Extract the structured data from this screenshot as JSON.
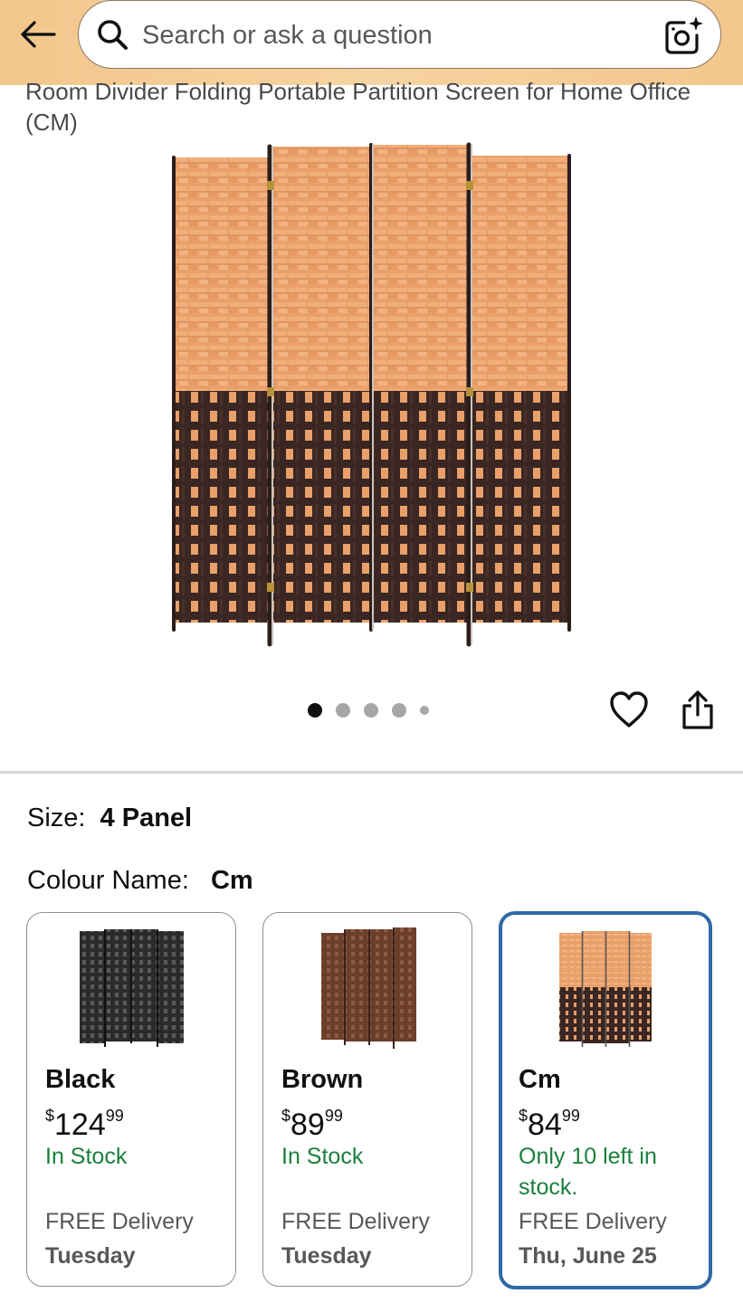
{
  "header": {
    "search_placeholder": "Search or ask a question",
    "back_icon": "arrow-left-icon",
    "camera_icon": "camera-sparkle-icon",
    "search_icon": "search-icon"
  },
  "product": {
    "title": "Room Divider Folding Portable Partition Screen for Home Office (CM)",
    "image_carousel": {
      "count": 5,
      "active_index": 0
    }
  },
  "options": {
    "size_label": "Size:",
    "size_value": "4 Panel",
    "colour_label": "Colour Name:",
    "colour_value": "Cm"
  },
  "variants": [
    {
      "name": "Black",
      "currency": "$",
      "price_whole": "124",
      "price_cents": "99",
      "stock": "In Stock",
      "delivery_label": "FREE Delivery",
      "delivery_day": "Tuesday",
      "selected": false
    },
    {
      "name": "Brown",
      "currency": "$",
      "price_whole": "89",
      "price_cents": "99",
      "stock": "In Stock",
      "delivery_label": "FREE Delivery",
      "delivery_day": "Tuesday",
      "selected": false
    },
    {
      "name": "Cm",
      "currency": "$",
      "price_whole": "84",
      "price_cents": "99",
      "stock": "Only 10 left in stock.",
      "delivery_label": "FREE Delivery",
      "delivery_day": "Thu, June 25",
      "selected": true
    }
  ],
  "colors": {
    "header_bg": "#f3c68c",
    "stock_green": "#1a7f3c",
    "selected_border": "#2f69a8"
  }
}
